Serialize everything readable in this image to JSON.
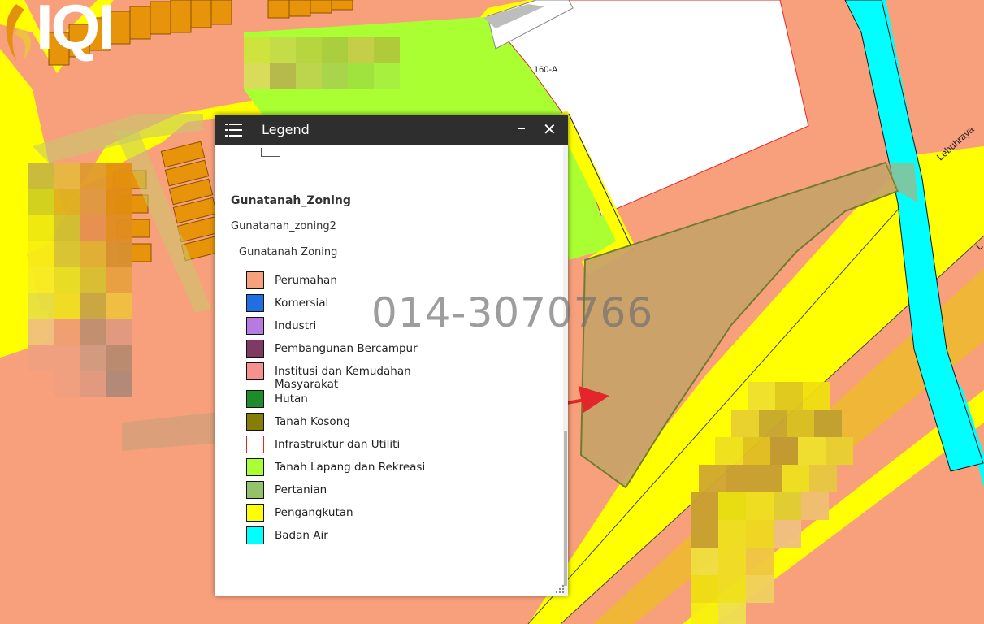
{
  "map": {
    "lot_label": "160-A",
    "road_label": "Lebuhraya",
    "road_label_2": "L",
    "watermark": "014-3070766",
    "logo_text": "IQI"
  },
  "legend": {
    "title": "Legend",
    "menu_icon": "hamburger-menu-icon",
    "minimize_icon": "minimize-icon",
    "close_icon": "close-icon",
    "layer_name": "Gunatanah_Zoning",
    "sublayer_name": "Gunatanah_zoning2",
    "group_name": "Gunatanah Zoning",
    "items": [
      {
        "label": "Perumahan",
        "color": "#f8a07c",
        "border": "#111"
      },
      {
        "label": "Komersial",
        "color": "#1f6fe0",
        "border": "#111"
      },
      {
        "label": "Industri",
        "color": "#b57be0",
        "border": "#111"
      },
      {
        "label": "Pembangunan Bercampur",
        "color": "#7f3a62",
        "border": "#111"
      },
      {
        "label": "Institusi dan Kemudahan Masyarakat",
        "color": "#f79090",
        "border": "#111"
      },
      {
        "label": "Hutan",
        "color": "#1e8c2a",
        "border": "#111"
      },
      {
        "label": "Tanah Kosong",
        "color": "#857d05",
        "border": "#111"
      },
      {
        "label": "Infrastruktur dan Utiliti",
        "color": "#ffffff",
        "border": "#e3262b"
      },
      {
        "label": "Tanah Lapang dan Rekreasi",
        "color": "#aaff33",
        "border": "#111"
      },
      {
        "label": "Pertanian",
        "color": "#93c26d",
        "border": "#111"
      },
      {
        "label": "Pengangkutan",
        "color": "#ffff00",
        "border": "#111"
      },
      {
        "label": "Badan Air",
        "color": "#00ffff",
        "border": "#111"
      }
    ]
  }
}
